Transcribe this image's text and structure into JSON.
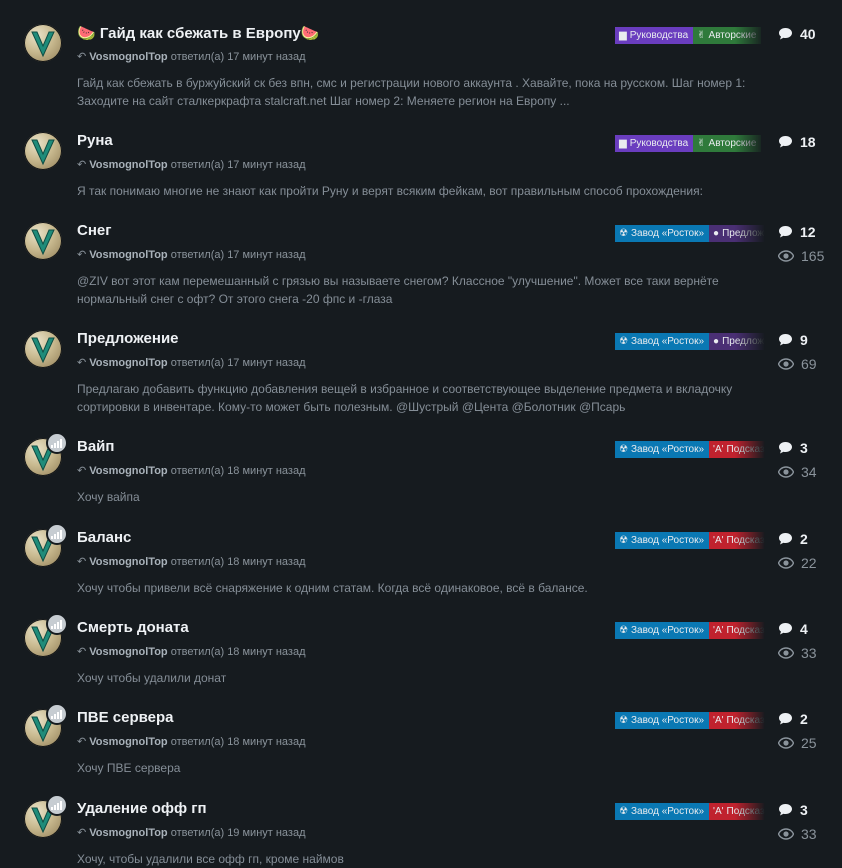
{
  "colors": {
    "guides": "#6a3dbf",
    "author": "#2f7a3b",
    "factory": "#0a78b3",
    "proposal": "#4a2f74",
    "support": "#c0222e"
  },
  "topics": [
    {
      "title": "🍉 Гайд как сбежать в Европу🍉",
      "user": "VosmognolTop",
      "action": "ответил(а) 17 минут назад",
      "excerpt": "Гайд как сбежать в буржуйский ск без впн, смс и регистрации нового аккаунта . Хавайте, пока на русском. Шаг номер 1: Заходите на сайт сталкеркрафта stalcraft.net Шаг номер 2: Меняете регион на Европу ...",
      "tags": [
        {
          "icon": "book-icon",
          "glyph": "▆",
          "label": "Руководства",
          "color": "#6a3dbf"
        },
        {
          "icon": "person-icon",
          "glyph": "✌",
          "label": "Авторские",
          "color": "#2f7a3b"
        }
      ],
      "replies": "40",
      "views": "",
      "rank": false
    },
    {
      "title": "Руна",
      "user": "VosmognolTop",
      "action": "ответил(а) 17 минут назад",
      "excerpt": "Я так понимаю многие не знают как пройти Руну и верят всяким фейкам, вот правильным способ прохождения:",
      "tags": [
        {
          "icon": "book-icon",
          "glyph": "▆",
          "label": "Руководства",
          "color": "#6a3dbf"
        },
        {
          "icon": "person-icon",
          "glyph": "✌",
          "label": "Авторские",
          "color": "#2f7a3b"
        }
      ],
      "replies": "18",
      "views": "",
      "rank": false
    },
    {
      "title": "Снег",
      "user": "VosmognolTop",
      "action": "ответил(а) 17 минут назад",
      "excerpt": "@ZIV вот этот кам перемешанный с грязью вы называете снегом? Классное \"улучшение\". Может все таки вернёте нормальный снег с офт? От этого снега -20 фпс и -глаза",
      "tags": [
        {
          "icon": "radiation-icon",
          "glyph": "☢",
          "label": "Завод «Росток»",
          "color": "#0a78b3"
        },
        {
          "icon": "lightbulb-icon",
          "glyph": "●",
          "label": "Предложения",
          "color": "#4a2f74"
        }
      ],
      "replies": "12",
      "views": "165",
      "rank": false
    },
    {
      "title": "Предложение",
      "user": "VosmognolTop",
      "action": "ответил(а) 17 минут назад",
      "excerpt": "Предлагаю добавить функцию добавления вещей в избранное и соответствующее выделение предмета и вкладочку сортировки в инвентаре. Кому-то может быть полезным. @Шустрый @Цента @Болотник @Псарь",
      "tags": [
        {
          "icon": "radiation-icon",
          "glyph": "☢",
          "label": "Завод «Росток»",
          "color": "#0a78b3"
        },
        {
          "icon": "lightbulb-icon",
          "glyph": "●",
          "label": "Предложения",
          "color": "#4a2f74"
        }
      ],
      "replies": "9",
      "views": "69",
      "rank": false
    },
    {
      "title": "Вайп",
      "user": "VosmognolTop",
      "action": "ответил(а) 18 минут назад",
      "excerpt": "Хочу вайпа",
      "tags": [
        {
          "icon": "radiation-icon",
          "glyph": "☢",
          "label": "Завод «Росток»",
          "color": "#0a78b3"
        },
        {
          "icon": "antenna-icon",
          "glyph": "'A'",
          "label": "Подсказки",
          "color": "#c0222e"
        }
      ],
      "replies": "3",
      "views": "34",
      "rank": true
    },
    {
      "title": "Баланс",
      "user": "VosmognolTop",
      "action": "ответил(а) 18 минут назад",
      "excerpt": "Хочу чтобы привели всё снаряжение к одним статам. Когда всё одинаковое, всё в балансе.",
      "tags": [
        {
          "icon": "radiation-icon",
          "glyph": "☢",
          "label": "Завод «Росток»",
          "color": "#0a78b3"
        },
        {
          "icon": "antenna-icon",
          "glyph": "'A'",
          "label": "Подсказки",
          "color": "#c0222e"
        }
      ],
      "replies": "2",
      "views": "22",
      "rank": true
    },
    {
      "title": "Смерть доната",
      "user": "VosmognolTop",
      "action": "ответил(а) 18 минут назад",
      "excerpt": "Хочу чтобы удалили донат",
      "tags": [
        {
          "icon": "radiation-icon",
          "glyph": "☢",
          "label": "Завод «Росток»",
          "color": "#0a78b3"
        },
        {
          "icon": "antenna-icon",
          "glyph": "'A'",
          "label": "Подсказки",
          "color": "#c0222e"
        }
      ],
      "replies": "4",
      "views": "33",
      "rank": true
    },
    {
      "title": "ПВЕ сервера",
      "user": "VosmognolTop",
      "action": "ответил(а) 18 минут назад",
      "excerpt": "Хочу ПВЕ сервера",
      "tags": [
        {
          "icon": "radiation-icon",
          "glyph": "☢",
          "label": "Завод «Росток»",
          "color": "#0a78b3"
        },
        {
          "icon": "antenna-icon",
          "glyph": "'A'",
          "label": "Подсказки",
          "color": "#c0222e"
        }
      ],
      "replies": "2",
      "views": "25",
      "rank": true
    },
    {
      "title": "Удаление офф гп",
      "user": "VosmognolTop",
      "action": "ответил(а) 19 минут назад",
      "excerpt": "Хочу, чтобы удалили все офф гп, кроме наймов",
      "tags": [
        {
          "icon": "radiation-icon",
          "glyph": "☢",
          "label": "Завод «Росток»",
          "color": "#0a78b3"
        },
        {
          "icon": "antenna-icon",
          "glyph": "'A'",
          "label": "Подсказки",
          "color": "#c0222e"
        }
      ],
      "replies": "3",
      "views": "33",
      "rank": true
    }
  ]
}
